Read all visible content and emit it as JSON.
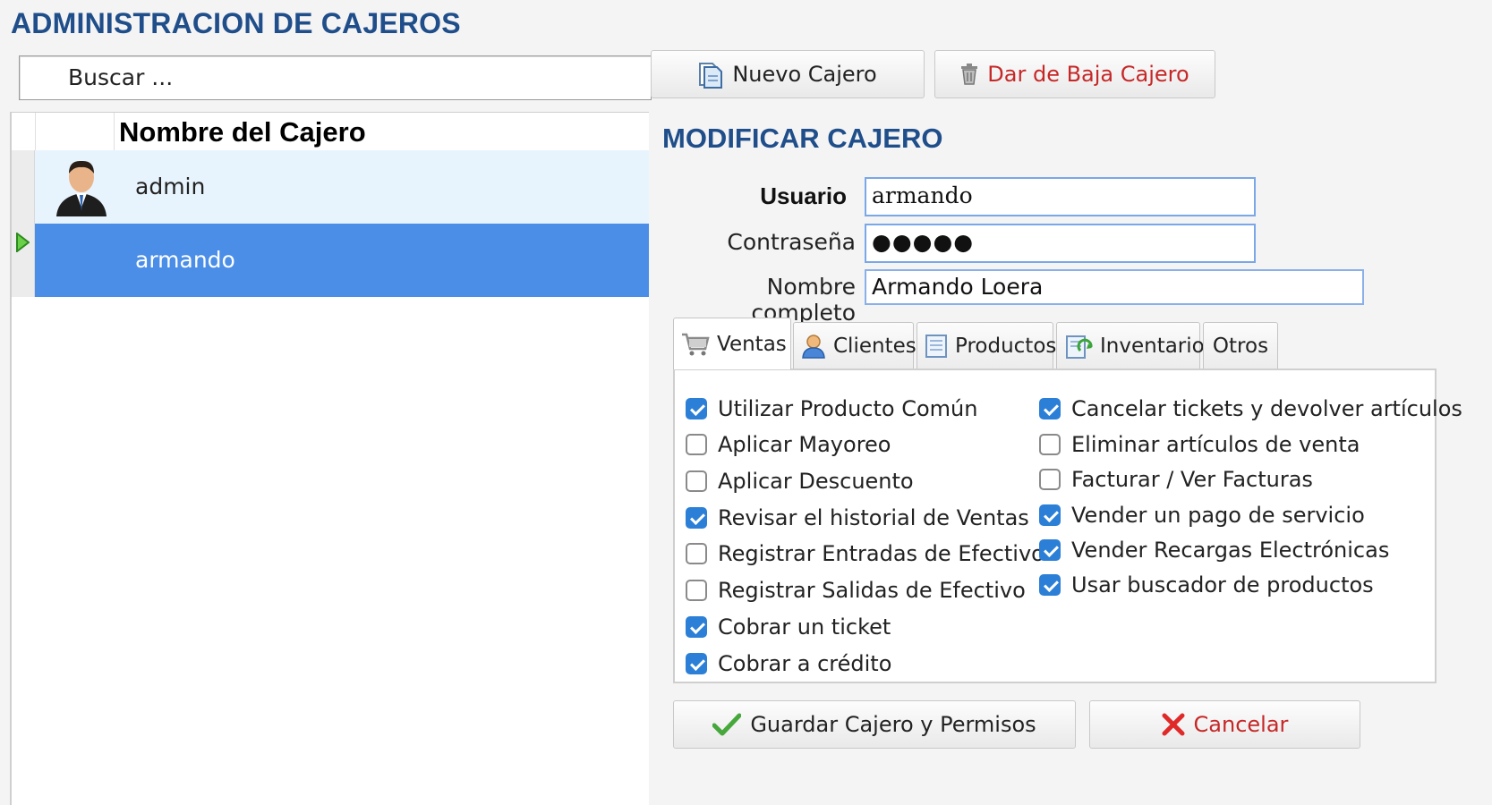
{
  "page": {
    "title": "ADMINISTRACION DE CAJEROS"
  },
  "search": {
    "value": "Buscar ..."
  },
  "grid": {
    "header": "Nombre del Cajero",
    "rows": [
      {
        "name": "admin",
        "has_avatar": true,
        "selected": false
      },
      {
        "name": "armando",
        "has_avatar": false,
        "selected": true
      }
    ]
  },
  "toolbar": {
    "new_label": "Nuevo Cajero",
    "delete_label": "Dar de Baja Cajero"
  },
  "form": {
    "title": "MODIFICAR CAJERO",
    "user_label": "Usuario",
    "user_value": "armando",
    "password_label": "Contraseña",
    "password_value": "●●●●●",
    "fullname_label": "Nombre completo",
    "fullname_value": "Armando Loera"
  },
  "tabs": [
    {
      "label": "Ventas",
      "icon": "cart-icon",
      "active": true
    },
    {
      "label": "Clientes",
      "icon": "user-icon",
      "active": false
    },
    {
      "label": "Productos",
      "icon": "document-icon",
      "active": false
    },
    {
      "label": "Inventario",
      "icon": "inventory-icon",
      "active": false
    },
    {
      "label": "Otros",
      "icon": "",
      "active": false
    }
  ],
  "permissions": {
    "left": [
      {
        "label": "Utilizar Producto Común",
        "checked": true
      },
      {
        "label": "Aplicar Mayoreo",
        "checked": false
      },
      {
        "label": "Aplicar Descuento",
        "checked": false
      },
      {
        "label": "Revisar el historial de Ventas",
        "checked": true
      },
      {
        "label": "Registrar Entradas de Efectivo",
        "checked": false
      },
      {
        "label": "Registrar Salidas de Efectivo",
        "checked": false
      },
      {
        "label": "Cobrar un ticket",
        "checked": true
      },
      {
        "label": "Cobrar a crédito",
        "checked": true
      }
    ],
    "right": [
      {
        "label": "Cancelar tickets y devolver artículos",
        "checked": true
      },
      {
        "label": "Eliminar artículos de venta",
        "checked": false
      },
      {
        "label": "Facturar / Ver Facturas",
        "checked": false
      },
      {
        "label": "Vender un pago de servicio",
        "checked": true
      },
      {
        "label": "Vender Recargas Electrónicas",
        "checked": true
      },
      {
        "label": "Usar buscador de productos",
        "checked": true
      }
    ]
  },
  "actions": {
    "save_label": "Guardar Cajero y Permisos",
    "cancel_label": "Cancelar"
  },
  "colors": {
    "title": "#1f4e8a",
    "selection": "#4b8ee8",
    "checkbox": "#2c7fd6"
  }
}
